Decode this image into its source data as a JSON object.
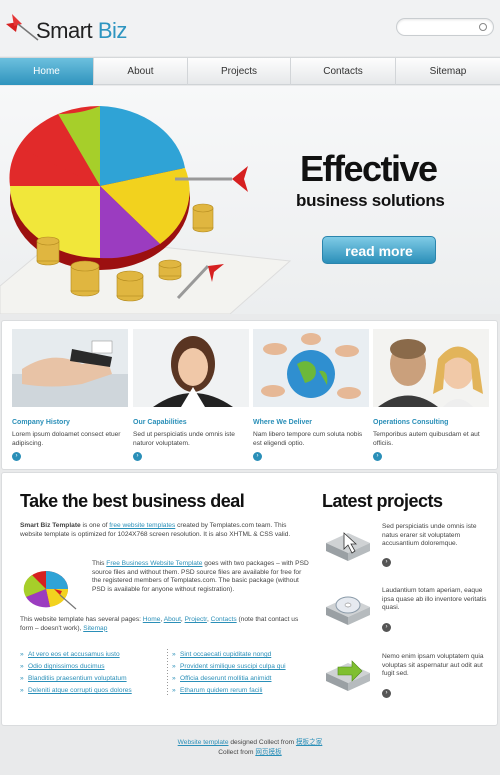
{
  "header": {
    "logo_word1": "Smart",
    "logo_word2": "Biz",
    "search_placeholder": ""
  },
  "nav": {
    "items": [
      "Home",
      "About",
      "Projects",
      "Contacts",
      "Sitemap"
    ],
    "active": "Home"
  },
  "hero": {
    "title": "Effective",
    "subtitle": "business solutions",
    "button": "read more"
  },
  "services": [
    {
      "title": "Company History",
      "text": "Lorem ipsum doloamet consect etuer adipiscing."
    },
    {
      "title": "Our Capabilities",
      "text": "Sed ut perspiciatis unde omnis iste naturor voluptatem."
    },
    {
      "title": "Where We Deliver",
      "text": "Nam libero tempore cum soluta nobis est eligendi optio."
    },
    {
      "title": "Operations Consulting",
      "text": "Temporibus autem quibusdam et aut officiis."
    }
  ],
  "deal": {
    "title": "Take the best business deal",
    "p1_bold": "Smart Biz Template",
    "p1_a": " is one of ",
    "p1_link": "free website templates",
    "p1_b": " created by Templates.com team. This website template is optimized for 1024X768 screen resolution. It is also XHTML & CSS valid.",
    "p2_a": "This ",
    "p2_link": "Free Business Website Template",
    "p2_b": " goes with two packages – with PSD source files and without them. PSD source files are available for free for the registered members of Templates.com. The basic package (without PSD is available for anyone without registration).",
    "p3_a": "This website template has several pages: ",
    "p3_l1": "Home",
    "p3_l2": "About",
    "p3_l3": "Projectr",
    "p3_l4": "Contacts",
    "p3_b": " (note that contact us form – doesn't work), ",
    "p3_l5": "Sitemap",
    "links_left": [
      "At vero eos et accusamus iusto",
      "Odio dignissimos ducimus",
      "Blanditiis praesentium voluptatum",
      "Deleniti atque corrupti quos dolores"
    ],
    "links_right": [
      "Sint occaecati cupiditate nongd",
      "Provident similique suscipi culpa qui",
      "Officia deserunt mollitia animidt",
      "Etharum quidem rerum facili"
    ]
  },
  "projects": {
    "title": "Latest projects",
    "items": [
      {
        "text": "Sed perspiciatis unde omnis iste natus erarer sit voluptatem accusantium doloremque."
      },
      {
        "text": "Laudantium totam aperiam, eaque ipsa quase ab illo inventore veritatis quasi."
      },
      {
        "text": "Nemo enim ipsam voluptatem quia voluptas sit aspernatur aut odit aut fugit sed."
      }
    ]
  },
  "footer": {
    "line1_link": "Website template",
    "line1_mid": " designed Collect from ",
    "line1_link2": "模板之家",
    "line2_a": "Collect from ",
    "line2_link": "网页模板"
  },
  "colors": {
    "accent": "#2d95c0",
    "nav_active": "#3a9cc4",
    "button": "#2b8fb9"
  }
}
